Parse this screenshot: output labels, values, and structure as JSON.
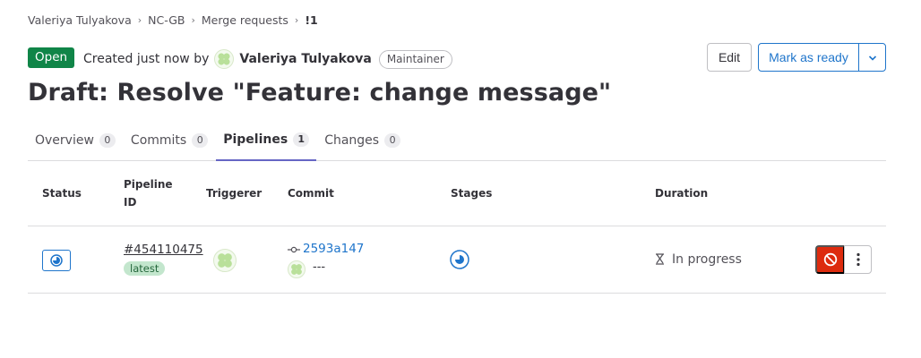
{
  "breadcrumb": {
    "items": [
      "Valeriya Tulyakova",
      "NC-GB",
      "Merge requests",
      "!1"
    ]
  },
  "header": {
    "status": "Open",
    "created_text": "Created just now by",
    "author": "Valeriya Tulyakova",
    "role": "Maintainer",
    "edit_label": "Edit",
    "ready_label": "Mark as ready",
    "title": "Draft: Resolve \"Feature: change message\""
  },
  "tabs": [
    {
      "label": "Overview",
      "count": "0"
    },
    {
      "label": "Commits",
      "count": "0"
    },
    {
      "label": "Pipelines",
      "count": "1"
    },
    {
      "label": "Changes",
      "count": "0"
    }
  ],
  "table": {
    "headers": {
      "status": "Status",
      "pipeline_id": "Pipeline ID",
      "triggerer": "Triggerer",
      "commit": "Commit",
      "stages": "Stages",
      "duration": "Duration"
    },
    "rows": [
      {
        "pipeline_id": "#454110475",
        "badge": "latest",
        "commit_sha": "2593a147",
        "commit_message": "---",
        "duration": "In progress"
      }
    ]
  },
  "colors": {
    "open_green": "#108548",
    "link_blue": "#1f75cb",
    "cancel_red": "#dd2b0e",
    "tab_active": "#6666c4"
  },
  "icons": {
    "breadcrumb_separator": "chevron-right-icon",
    "caret": "chevron-down-icon",
    "status": "status-running-icon",
    "commit": "commit-icon",
    "duration": "hourglass-icon",
    "cancel": "cancel-icon",
    "more": "ellipsis-v-icon"
  }
}
